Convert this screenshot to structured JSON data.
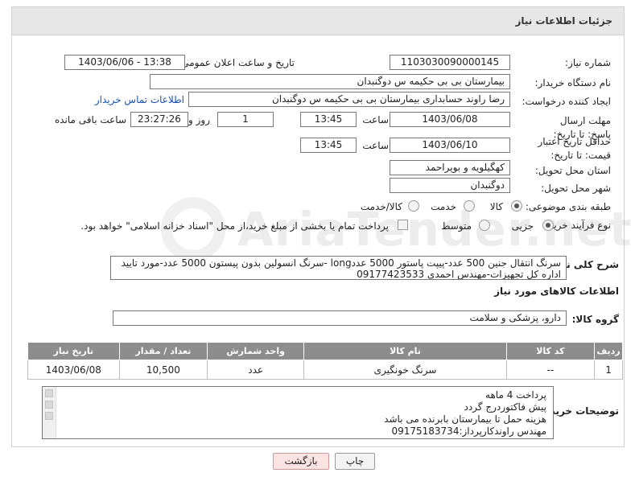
{
  "header": {
    "title": "جزئیات اطلاعات نیاز"
  },
  "fields": {
    "need_number_label": "شماره نیاز:",
    "need_number": "1103030090000145",
    "announce_label": "تاریخ و ساعت اعلان عمومی:",
    "announce_value": "1403/06/06 - 13:38",
    "buyer_org_label": "نام دستگاه خریدار:",
    "buyer_org": "بیمارستان بی بی حکیمه س  دوگنبدان",
    "requester_label": "ایجاد کننده درخواست:",
    "requester": "رضا راوند حسابداری بیمارستان بی بی حکیمه س  دوگنبدان",
    "contact_link": "اطلاعات تماس خریدار",
    "reply_deadline_label": "مهلت ارسال پاسخ: تا تاریخ:",
    "reply_date": "1403/06/08",
    "time_label": "ساعت",
    "reply_time": "13:45",
    "days_value": "1",
    "days_label": "روز و",
    "remaining_time": "23:27:26",
    "remaining_label": "ساعت باقی مانده",
    "price_validity_label": "حداقل تاریخ اعتبار قیمت: تا تاریخ:",
    "price_date": "1403/06/10",
    "price_time": "13:45",
    "province_label": "استان محل تحویل:",
    "province": "کهگیلویه و بویراحمد",
    "city_label": "شهر محل تحویل:",
    "city": "دوگنبدان",
    "category_label": "طبقه بندی موضوعی:",
    "category_options": [
      "کالا",
      "خدمت",
      "کالا/خدمت"
    ],
    "process_label": "نوع فرآیند خرید :",
    "process_options": [
      "جزیی",
      "متوسط"
    ],
    "payment_note": "پرداخت تمام یا بخشی از مبلغ خرید،از محل \"اسناد خزانه اسلامی\" خواهد بود."
  },
  "description": {
    "label": "شرح کلی نیاز:",
    "text": "سرنگ انتقال جنین 500 عدد-پیپت پاستور 5000 عددlong -سرنگ انسولین بدون پیستون 5000 عدد-مورد تایید اداره کل تجهیزات-مهندس احمدی 09177423533"
  },
  "goods_section": {
    "title": "اطلاعات کالاهای مورد نیاز",
    "group_label": "گروه کالا:",
    "group_value": "دارو، پزشکی و سلامت"
  },
  "table": {
    "headers": [
      "ردیف",
      "کد کالا",
      "نام کالا",
      "واحد شمارش",
      "تعداد / مقدار",
      "تاریخ نیاز"
    ],
    "rows": [
      [
        "1",
        "--",
        "سرنگ خونگیری",
        "عدد",
        "10,500",
        "1403/06/08"
      ]
    ]
  },
  "buyer_notes": {
    "label": "توضیحات خریدار:",
    "text": "پرداخت 4 ماهه\nپیش فاکتوردرج گردد\nهزینه حمل تا بیمارستان بابرنده می باشد\nمهندس راوندکارپرداز:09175183734"
  },
  "buttons": {
    "print": "چاپ",
    "back": "بازگشت"
  },
  "watermark": {
    "text": "AriaTender.net"
  }
}
